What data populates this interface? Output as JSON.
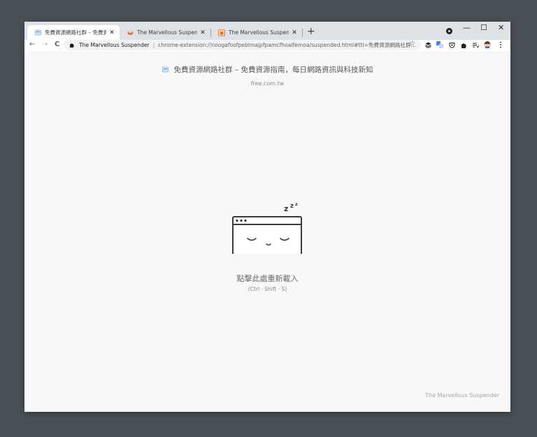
{
  "tabs": [
    {
      "title": "免費資源網路社群 – 免費資源指",
      "favicon": "page-favicon-icon"
    },
    {
      "title": "The Marvellous Suspender - Ch",
      "favicon": "suspender-favicon-icon"
    },
    {
      "title": "The Marvellous Suspender - 設",
      "favicon": "suspender-favicon-icon"
    }
  ],
  "tabstrip": {
    "close": "✕",
    "new_tab": "+",
    "minimize": "—",
    "maximize": "☐",
    "close_window": "✕"
  },
  "toolbar": {
    "back": "←",
    "forward": "→",
    "reload": "C",
    "star": "☆"
  },
  "omnibox": {
    "site_name": "The Marvellous Suspender",
    "separator": "|",
    "url": "chrome-extension://noogafoofpebimajpfpamcfhoaifemoa/suspended.html#ttl=免費資源網路社群..."
  },
  "page": {
    "title": "免費資源網路社群 – 免費資源指南，每日網路資訊與科技新知",
    "url": "free.com.tw",
    "sleep_text": "z",
    "reload_text": "點擊此處重新載入",
    "hotkey": "(Ctrl · Shift · S)",
    "footer": "The Marvellous Suspender"
  },
  "colors": {
    "frame": "#dee1e6",
    "background": "#4a5058",
    "page": "#f8f8f8",
    "accent": "#e8712b"
  }
}
